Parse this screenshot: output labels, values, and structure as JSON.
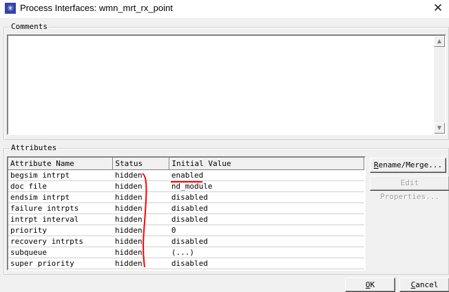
{
  "window": {
    "title": "Process Interfaces: wmn_mrt_rx_point",
    "icon": "star-app-icon",
    "close_glyph": "✕"
  },
  "comments": {
    "label": "Comments",
    "value": ""
  },
  "attributes": {
    "label": "Attributes",
    "columns": [
      "Attribute Name",
      "Status",
      "Initial Value"
    ],
    "rows": [
      {
        "name": "begsim intrpt",
        "status": "hidden",
        "value": "enabled"
      },
      {
        "name": "doc file",
        "status": "hidden",
        "value": "nd_module"
      },
      {
        "name": "endsim intrpt",
        "status": "hidden",
        "value": "disabled"
      },
      {
        "name": "failure intrpts",
        "status": "hidden",
        "value": "disabled"
      },
      {
        "name": "intrpt interval",
        "status": "hidden",
        "value": "disabled"
      },
      {
        "name": "priority",
        "status": "hidden",
        "value": "0"
      },
      {
        "name": "recovery intrpts",
        "status": "hidden",
        "value": "disabled"
      },
      {
        "name": "subqueue",
        "status": "hidden",
        "value": "(...)"
      },
      {
        "name": "super priority",
        "status": "hidden",
        "value": "disabled"
      }
    ]
  },
  "buttons": {
    "rename_merge": "Rename/Merge...",
    "rename_merge_hotkey": "R",
    "rename_merge_rest": "ename/Merge...",
    "edit_properties": "Edit Properties...",
    "ok_hotkey": "O",
    "ok_rest": "K",
    "cancel_hotkey": "C",
    "cancel_rest": "ancel"
  },
  "colors": {
    "annotation": "#ff0000",
    "app_icon": "#3344aa"
  }
}
